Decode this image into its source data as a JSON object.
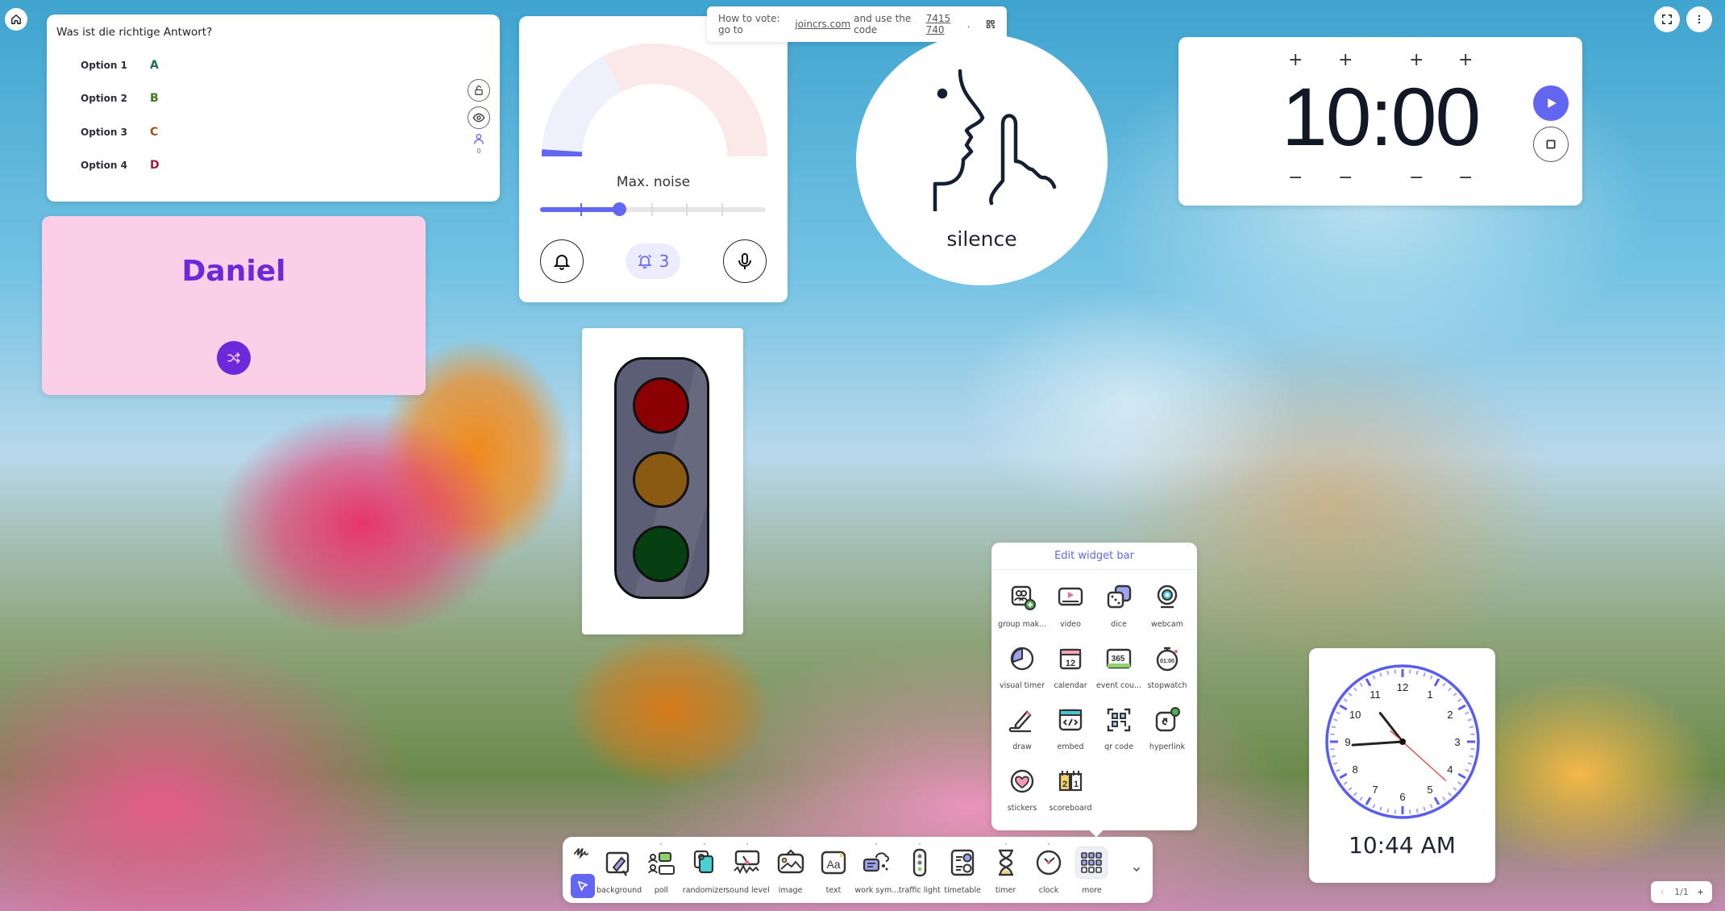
{
  "topbar": {
    "home_icon": "home-icon",
    "fullscreen_icon": "fullscreen-icon",
    "menu_icon": "more-vertical-icon"
  },
  "poll": {
    "question": "Was ist die richtige Antwort?",
    "options": [
      {
        "label": "Option 1",
        "letter": "A",
        "color": "#1b6b5a"
      },
      {
        "label": "Option 2",
        "letter": "B",
        "color": "#3f7a1c"
      },
      {
        "label": "Option 3",
        "letter": "C",
        "color": "#a0521c"
      },
      {
        "label": "Option 4",
        "letter": "D",
        "color": "#a11c3a"
      }
    ],
    "participant_count": "0",
    "controls": [
      "lock-open-icon",
      "eye-icon",
      "user-icon"
    ]
  },
  "vote_banner": {
    "prefix": "How to vote: go to",
    "link": "joincrs.com",
    "middle": "and use the code",
    "code": "7415 740",
    "suffix": ".",
    "icon": "qr-code-icon"
  },
  "randomizer": {
    "name": "Daniel",
    "background": "#fccfe9",
    "accent": "#6d28d9",
    "shuffle_icon": "shuffle-icon"
  },
  "sound_level": {
    "label": "Max. noise",
    "current_level_fraction": 0.02,
    "threshold_fraction": 0.35,
    "gauge_safe_color": "#eef0fb",
    "gauge_loud_color": "#fbe8e8",
    "accent": "#6366f1",
    "alarm_count": "3",
    "bell_icon": "bell-icon",
    "alarm_icon": "alarm-clock-icon",
    "mic_icon": "microphone-icon"
  },
  "silence": {
    "word": "silence",
    "icon": "shush-face-icon"
  },
  "timer": {
    "time": "10:00",
    "plus": "+",
    "minus": "−",
    "play_icon": "play-icon",
    "stop_icon": "stop-icon",
    "accent": "#6366f1"
  },
  "traffic_light": {
    "lamps": [
      {
        "name": "red",
        "color": "#8b0000"
      },
      {
        "name": "yellow",
        "color": "#8a5a12"
      },
      {
        "name": "green",
        "color": "#063f10"
      }
    ],
    "housing_color": "#5b5e74"
  },
  "widget_popover": {
    "title": "Edit widget bar",
    "items": [
      {
        "label": "group mak...",
        "icon": "group-maker-icon"
      },
      {
        "label": "video",
        "icon": "video-icon"
      },
      {
        "label": "dice",
        "icon": "dice-icon"
      },
      {
        "label": "webcam",
        "icon": "webcam-icon"
      },
      {
        "label": "visual timer",
        "icon": "visual-timer-icon"
      },
      {
        "label": "calendar",
        "icon": "calendar-icon"
      },
      {
        "label": "event cou...",
        "icon": "event-counter-icon"
      },
      {
        "label": "stopwatch",
        "icon": "stopwatch-icon"
      },
      {
        "label": "draw",
        "icon": "draw-icon"
      },
      {
        "label": "embed",
        "icon": "embed-icon"
      },
      {
        "label": "qr code",
        "icon": "qr-code-icon"
      },
      {
        "label": "hyperlink",
        "icon": "hyperlink-icon"
      },
      {
        "label": "stickers",
        "icon": "stickers-icon"
      },
      {
        "label": "scoreboard",
        "icon": "scoreboard-icon"
      }
    ],
    "calendar_day": "12",
    "event_counter_text": "365",
    "stopwatch_text": "01:00",
    "scoreboard_left": "2",
    "scoreboard_right": "1"
  },
  "toolbar": {
    "draw_icon": "scribble-icon",
    "select_icon": "cursor-arrow-icon",
    "items": [
      {
        "label": "background",
        "icon": "background-icon",
        "active_dot": false
      },
      {
        "label": "poll",
        "icon": "poll-icon",
        "active_dot": true
      },
      {
        "label": "randomizer",
        "icon": "randomizer-icon",
        "active_dot": true
      },
      {
        "label": "sound level",
        "icon": "sound-level-icon",
        "active_dot": true
      },
      {
        "label": "image",
        "icon": "image-icon",
        "active_dot": false
      },
      {
        "label": "text",
        "icon": "text-icon",
        "active_dot": false
      },
      {
        "label": "work sym...",
        "icon": "work-symbols-icon",
        "active_dot": true
      },
      {
        "label": "traffic light",
        "icon": "traffic-light-icon",
        "active_dot": true
      },
      {
        "label": "timetable",
        "icon": "timetable-icon",
        "active_dot": false
      },
      {
        "label": "timer",
        "icon": "timer-icon",
        "active_dot": true
      },
      {
        "label": "clock",
        "icon": "clock-icon",
        "active_dot": true
      },
      {
        "label": "more",
        "icon": "grid-icon",
        "active_dot": false
      }
    ],
    "collapse_icon": "chevron-down-icon"
  },
  "clock": {
    "digital_time": "10:44 AM",
    "hour": 10,
    "minute": 44,
    "second": 22,
    "numerals": [
      "12",
      "1",
      "2",
      "3",
      "4",
      "5",
      "6",
      "7",
      "8",
      "9",
      "10",
      "11"
    ],
    "ring_color": "#5b5cf0",
    "second_hand_color": "#e05555"
  },
  "pager": {
    "prev_icon": "chevron-left-icon",
    "page": "1/1",
    "add_icon": "plus-icon"
  }
}
